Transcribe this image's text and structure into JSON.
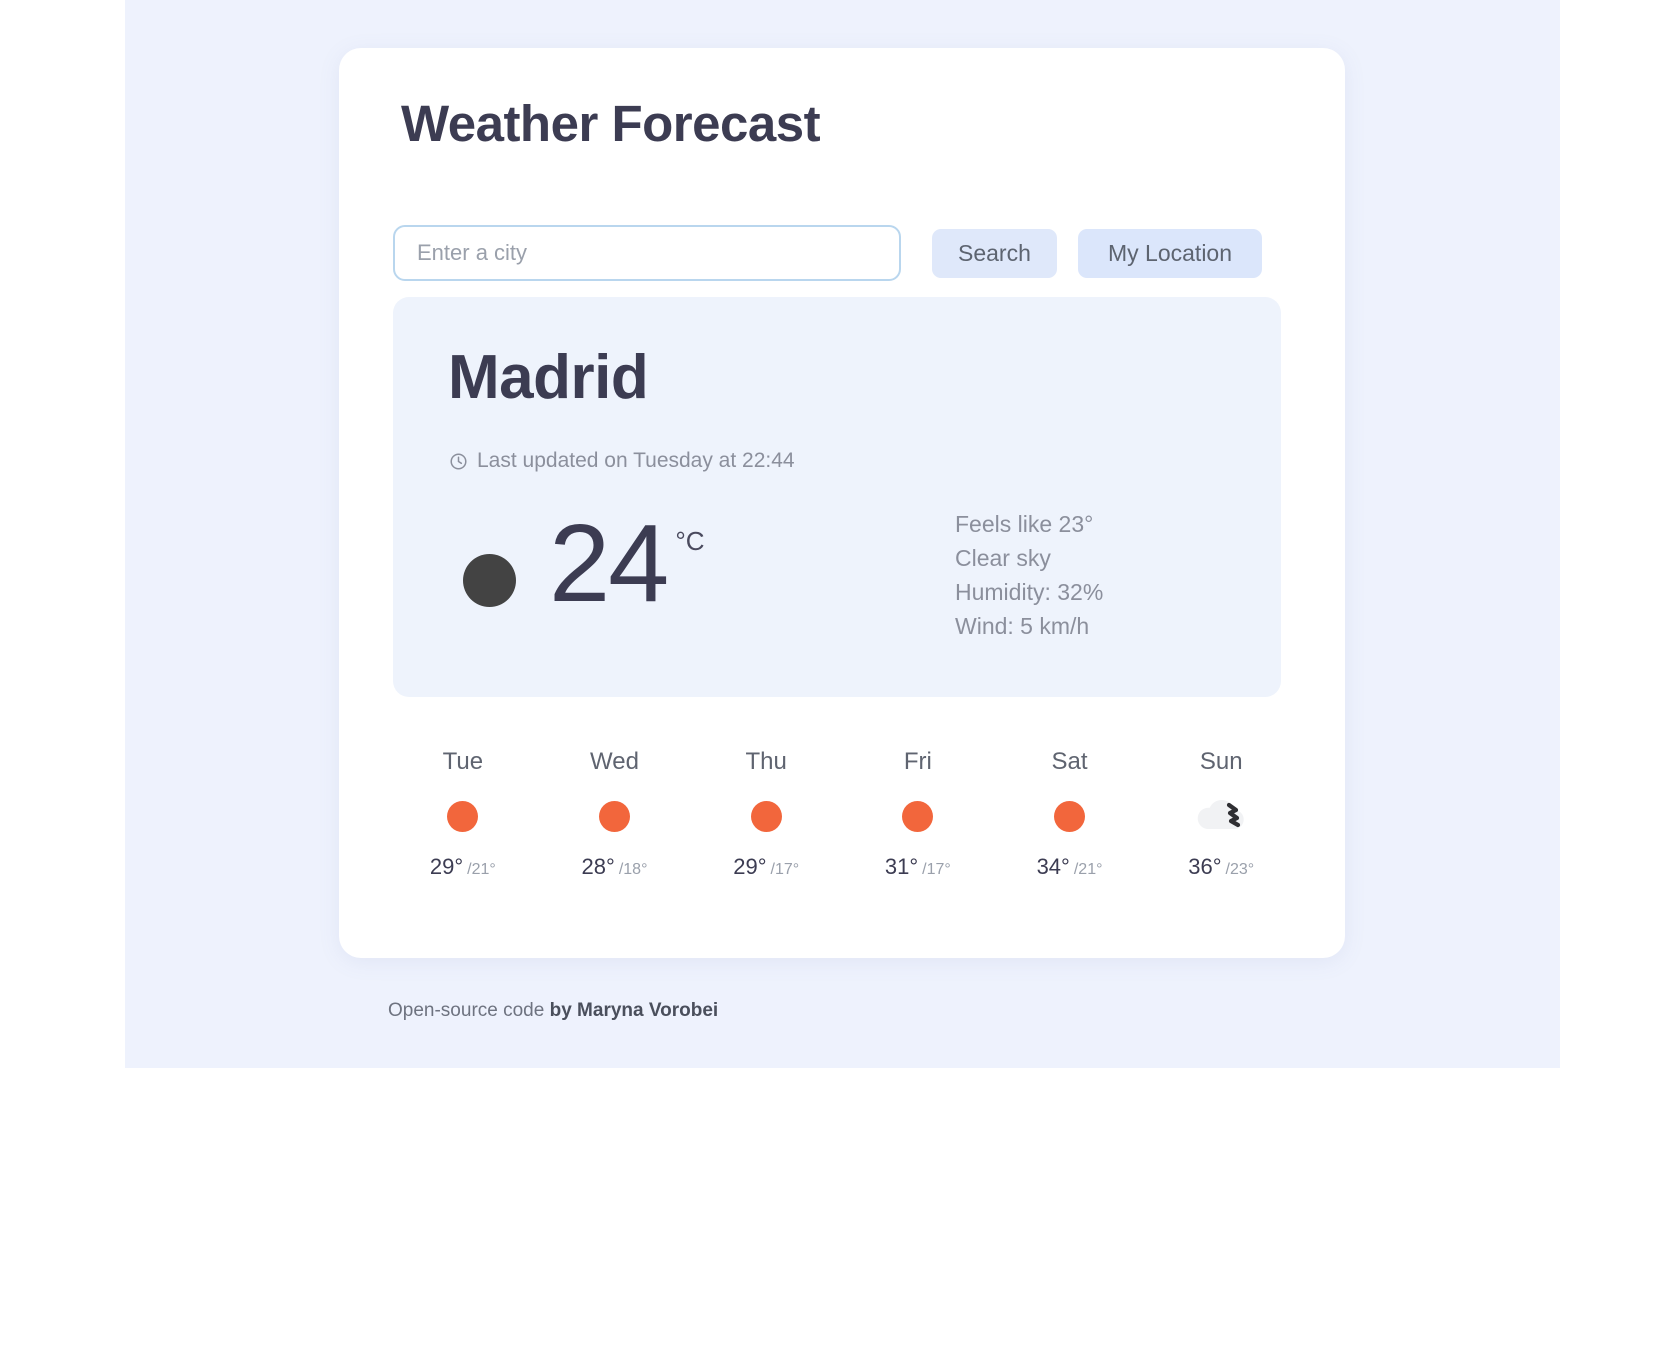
{
  "header": {
    "title": "Weather Forecast"
  },
  "search": {
    "placeholder": "Enter a city",
    "value": "",
    "search_label": "Search",
    "my_location_label": "My Location"
  },
  "current": {
    "city": "Madrid",
    "updated_text": "Last updated on Tuesday at 22:44",
    "clock_icon": "clock-icon",
    "condition_icon": "weather-condition-icon",
    "temperature": "24",
    "unit": "°C",
    "feels_like": "Feels like 23°",
    "description": "Clear sky",
    "humidity": "Humidity: 32%",
    "wind": "Wind: 5 km/h"
  },
  "forecast": {
    "days": [
      {
        "day": "Tue",
        "icon": "sun-icon",
        "max": "29°",
        "min": "/21°"
      },
      {
        "day": "Wed",
        "icon": "sun-icon",
        "max": "28°",
        "min": "/18°"
      },
      {
        "day": "Thu",
        "icon": "sun-icon",
        "max": "29°",
        "min": "/17°"
      },
      {
        "day": "Fri",
        "icon": "sun-icon",
        "max": "31°",
        "min": "/17°"
      },
      {
        "day": "Sat",
        "icon": "sun-icon",
        "max": "34°",
        "min": "/21°"
      },
      {
        "day": "Sun",
        "icon": "cloud-icon",
        "max": "36°",
        "min": "/23°"
      }
    ]
  },
  "footer": {
    "prefix": "Open-source code ",
    "author": "by Maryna Vorobei"
  },
  "colors": {
    "page_background": "#eef2fd",
    "card_background": "#ffffff",
    "panel_background": "#eef3fc",
    "button_background": "#dfe8fa",
    "accent_orange": "#f2663c",
    "text_dark": "#3c3c52",
    "text_muted": "#8b8f9c",
    "input_border": "#b9d6ee"
  }
}
